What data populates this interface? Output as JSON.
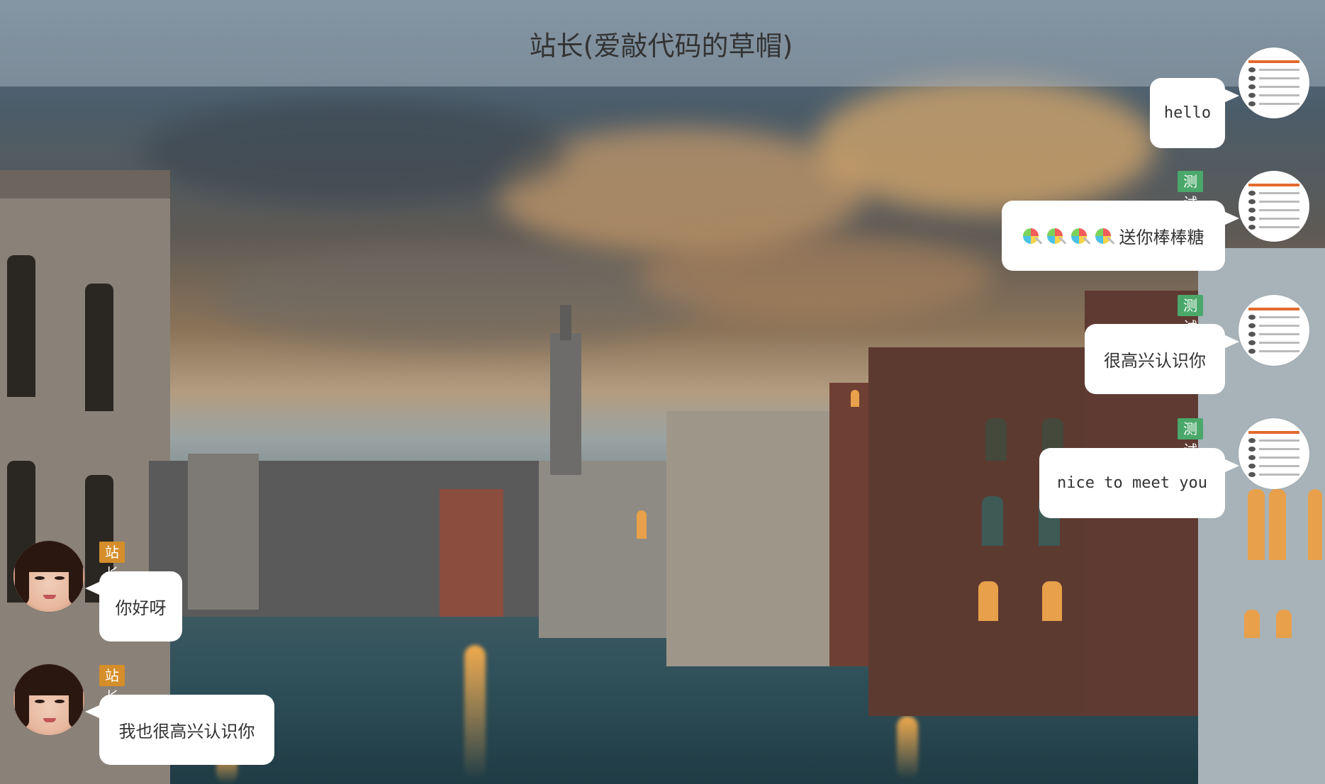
{
  "header": {
    "title": "站长(爱敲代码的草帽)"
  },
  "messages": [
    {
      "side": "right",
      "tag": "",
      "text": "hello"
    },
    {
      "side": "right",
      "tag": "测试",
      "text": "送你棒棒糖",
      "emoji_prefix": "lollipop-icon x4"
    },
    {
      "side": "right",
      "tag": "测试",
      "text": "很高兴认识你"
    },
    {
      "side": "right",
      "tag": "测试",
      "text": "nice to meet you"
    },
    {
      "side": "left",
      "tag": "站长",
      "text": "你好呀"
    },
    {
      "side": "left",
      "tag": "站长",
      "text": "我也很高兴认识你"
    }
  ],
  "colors": {
    "tag_green": "#4aa86a",
    "tag_orange": "#d58e2a",
    "header_bg": "rgba(163,174,186,0.55)"
  }
}
